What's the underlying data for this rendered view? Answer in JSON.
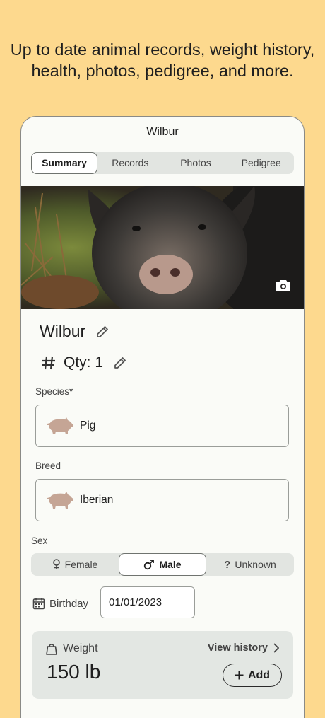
{
  "headline": {
    "line1": "Up to date animal records, weight history,",
    "line2": "health, photos, pedigree, and more."
  },
  "app": {
    "title": "Wilbur",
    "tabs": [
      "Summary",
      "Records",
      "Photos",
      "Pedigree"
    ],
    "active_tab": "Summary"
  },
  "animal": {
    "name": "Wilbur",
    "qty_label": "Qty: 1"
  },
  "species": {
    "label": "Species",
    "required_mark": "*",
    "value": "Pig",
    "icon": "pig-icon"
  },
  "breed": {
    "label": "Breed",
    "value": "Iberian",
    "icon": "pig-icon"
  },
  "sex": {
    "label": "Sex",
    "options": [
      "Female",
      "Male",
      "Unknown"
    ],
    "selected": "Male"
  },
  "birthday": {
    "label": "Birthday",
    "value": "01/01/2023"
  },
  "weight": {
    "label": "Weight",
    "value": "150 lb",
    "history_label": "View history",
    "add_label": "Add"
  },
  "colors": {
    "page_bg": "#FDD98E",
    "card_bg": "#fafbf7",
    "segment_bg": "#e2e5e1",
    "weight_card_bg": "#e3e7e3",
    "pig_icon": "#c5a595"
  }
}
